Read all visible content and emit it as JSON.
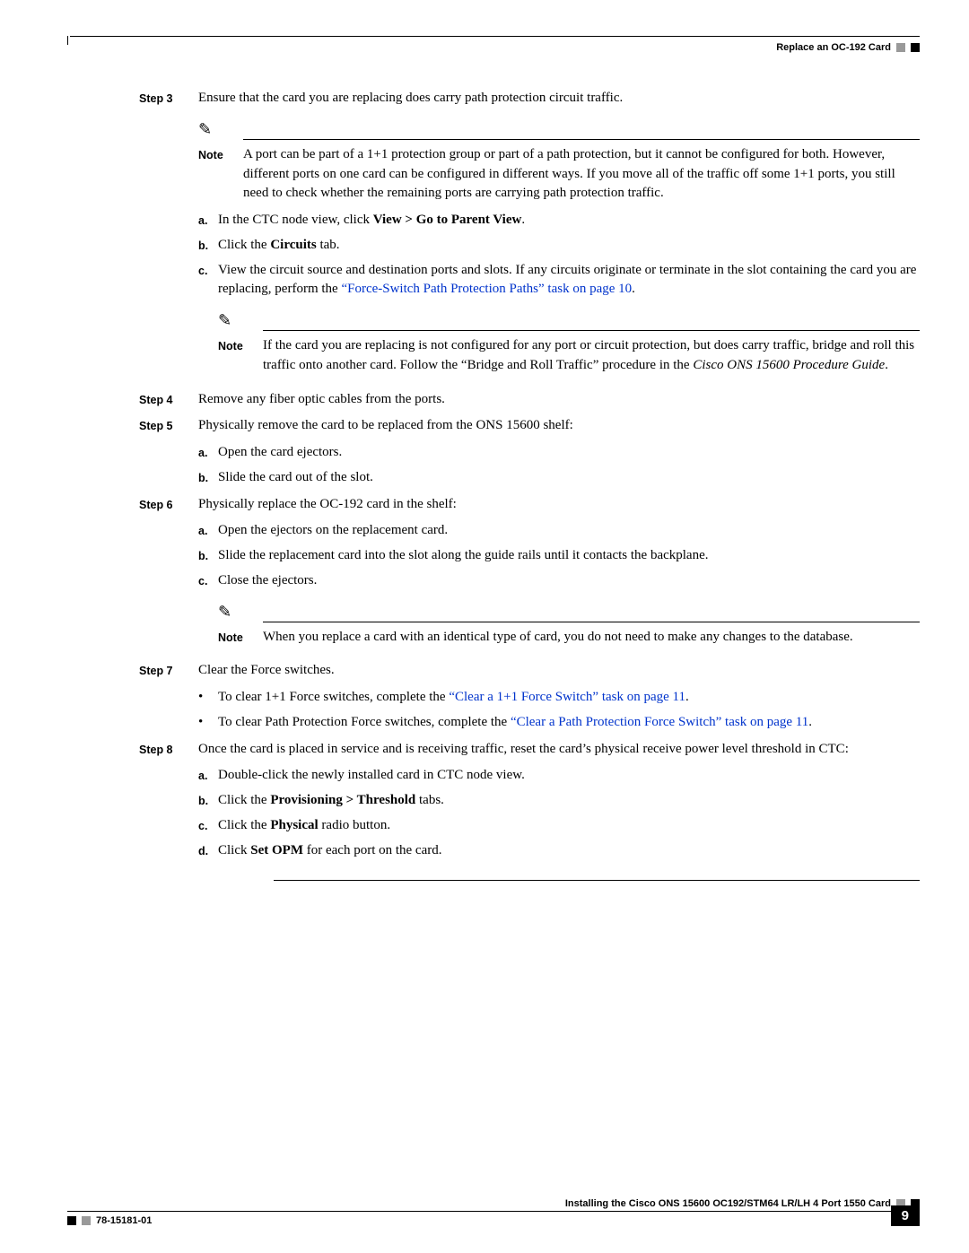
{
  "header": {
    "section": "Replace an OC-192 Card"
  },
  "steps": {
    "s3": {
      "label": "Step 3",
      "text": "Ensure that the card you are replacing does carry path protection circuit traffic."
    },
    "note1": {
      "label": "Note",
      "text": "A port can be part of a 1+1 protection group or part of a path protection, but it cannot be configured for both. However, different ports on one card can be configured in different ways. If you move all of the traffic off some 1+1 ports, you still need to check whether the remaining ports are carrying path protection traffic."
    },
    "s3a": {
      "m": "a.",
      "pre": "In the CTC node view, click ",
      "bold": "View > Go to Parent View",
      "post": "."
    },
    "s3b": {
      "m": "b.",
      "pre": "Click the ",
      "bold": "Circuits",
      "post": " tab."
    },
    "s3c": {
      "m": "c.",
      "pre": "View the circuit source and destination ports and slots. If any circuits originate or terminate in the slot containing the card you are replacing, perform the ",
      "link": "“Force-Switch Path Protection Paths” task on page 10",
      "post": "."
    },
    "note2": {
      "label": "Note",
      "pre": "If the card you are replacing is not configured for any port or circuit protection, but does carry traffic, bridge and roll this traffic onto another card. Follow the “Bridge and Roll Traffic” procedure in the ",
      "italic": "Cisco ONS 15600 Procedure Guide",
      "post": "."
    },
    "s4": {
      "label": "Step 4",
      "text": "Remove any fiber optic cables from the ports."
    },
    "s5": {
      "label": "Step 5",
      "text": "Physically remove the card to be replaced from the ONS 15600 shelf:"
    },
    "s5a": {
      "m": "a.",
      "text": "Open the card ejectors."
    },
    "s5b": {
      "m": "b.",
      "text": "Slide the card out of the slot."
    },
    "s6": {
      "label": "Step 6",
      "text": "Physically replace the OC-192 card in the shelf:"
    },
    "s6a": {
      "m": "a.",
      "text": "Open the ejectors on the replacement card."
    },
    "s6b": {
      "m": "b.",
      "text": "Slide the replacement card into the slot along the guide rails until it contacts the backplane."
    },
    "s6c": {
      "m": "c.",
      "text": "Close the ejectors."
    },
    "note3": {
      "label": "Note",
      "text": "When you replace a card with an identical type of card, you do not need to make any changes to the database."
    },
    "s7": {
      "label": "Step 7",
      "text": "Clear the Force switches."
    },
    "s7b1": {
      "pre": "To clear 1+1 Force switches, complete the ",
      "link": "“Clear a 1+1 Force Switch” task on page 11",
      "post": "."
    },
    "s7b2": {
      "pre": "To clear Path Protection Force switches, complete the ",
      "link": "“Clear a Path Protection Force Switch” task on page 11",
      "post": "."
    },
    "s8": {
      "label": "Step 8",
      "text": "Once the card is placed in service and is receiving traffic, reset the card’s physical receive power level threshold in CTC:"
    },
    "s8a": {
      "m": "a.",
      "text": "Double-click the newly installed card in CTC node view."
    },
    "s8b": {
      "m": "b.",
      "pre": "Click the ",
      "bold": "Provisioning > Threshold",
      "post": " tabs."
    },
    "s8c": {
      "m": "c.",
      "pre": "Click the ",
      "bold": "Physical",
      "post": " radio button."
    },
    "s8d": {
      "m": "d.",
      "pre": "Click ",
      "bold": "Set OPM",
      "post": " for each port on the card."
    }
  },
  "footer": {
    "title": "Installing the Cisco ONS 15600 OC192/STM64 LR/LH 4 Port 1550 Card",
    "docnum": "78-15181-01",
    "page": "9"
  }
}
